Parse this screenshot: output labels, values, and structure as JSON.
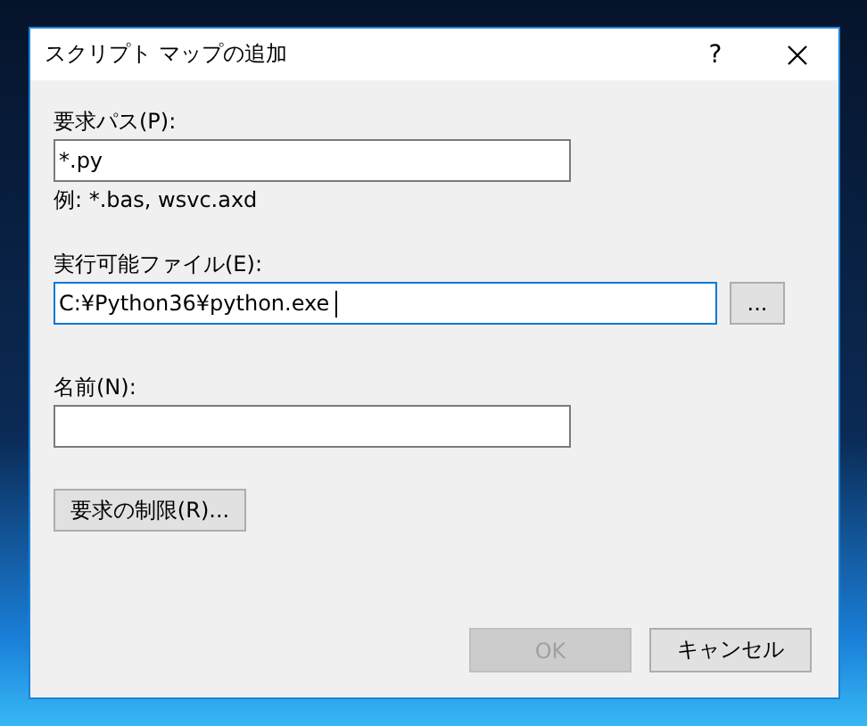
{
  "window": {
    "title": "スクリプト マップの追加",
    "help": "?"
  },
  "fields": [
    {
      "label": "要求パス(P):",
      "value": "*.py",
      "hint": "例: *.bas, wsvc.axd",
      "focused": false
    },
    {
      "label": "実行可能ファイル(E):",
      "value": "C:¥Python36¥python.exe",
      "focused": true,
      "browse_button": "..."
    },
    {
      "label": "名前(N):",
      "focused": false
    }
  ],
  "restrictions_button": "要求の制限(R)...",
  "buttons": [
    {
      "label": "OK",
      "disabled": true
    },
    {
      "label": "キャンセル",
      "disabled": false
    }
  ]
}
